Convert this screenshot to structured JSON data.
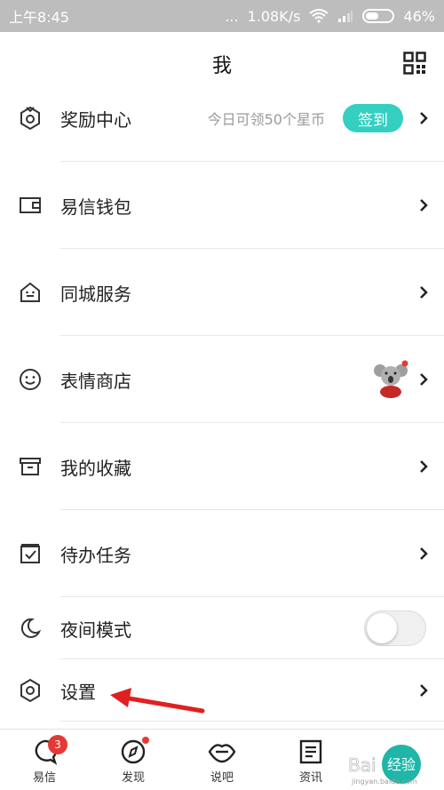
{
  "statusbar": {
    "time": "上午8:45",
    "dots": "...",
    "speed": "1.08K/s",
    "battery": "46%"
  },
  "header": {
    "title": "我"
  },
  "menu": {
    "reward": {
      "label": "奖励中心",
      "subtitle": "今日可领50个星币",
      "signin": "签到"
    },
    "wallet": {
      "label": "易信钱包"
    },
    "city": {
      "label": "同城服务"
    },
    "sticker": {
      "label": "表情商店"
    },
    "favorites": {
      "label": "我的收藏"
    },
    "todo": {
      "label": "待办任务"
    },
    "night": {
      "label": "夜间模式",
      "enabled": false
    },
    "settings": {
      "label": "设置"
    }
  },
  "bottomnav": {
    "tabs": [
      {
        "label": "易信",
        "badge": "3"
      },
      {
        "label": "发现"
      },
      {
        "label": "说吧"
      },
      {
        "label": "资讯"
      }
    ]
  },
  "colors": {
    "accent": "#35cfc2",
    "badge": "#e53935",
    "annotation": "#e02020"
  },
  "watermark": {
    "text": "经验",
    "brand": "Bai",
    "sub": "jingyan.baidu.com"
  }
}
